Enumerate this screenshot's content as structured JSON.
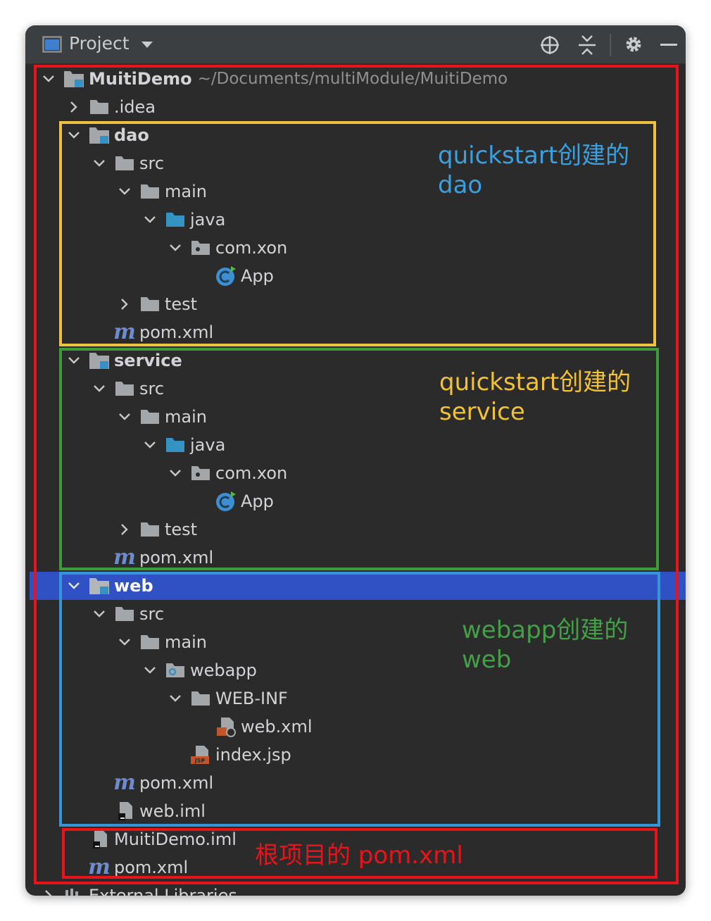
{
  "toolbar": {
    "title": "Project",
    "icons": [
      "window-icon",
      "dropdown-icon",
      "locate-icon",
      "collapse-icon",
      "gear-icon",
      "minimize-icon"
    ]
  },
  "tree": {
    "root": {
      "name": "MuitiDemo",
      "path": "~/Documents/multiModule/MuitiDemo"
    },
    "idea": ".idea",
    "dao": {
      "name": "dao",
      "src": "src",
      "main": "main",
      "java": "java",
      "pkg": "com.xon",
      "app": "App",
      "test": "test",
      "pom": "pom.xml"
    },
    "service": {
      "name": "service",
      "src": "src",
      "main": "main",
      "java": "java",
      "pkg": "com.xon",
      "app": "App",
      "test": "test",
      "pom": "pom.xml"
    },
    "web": {
      "name": "web",
      "src": "src",
      "main": "main",
      "webapp": "webapp",
      "webinf": "WEB-INF",
      "webxml": "web.xml",
      "index": "index.jsp",
      "pom": "pom.xml",
      "iml": "web.iml"
    },
    "root_iml": "MuitiDemo.iml",
    "root_pom": "pom.xml",
    "external": "External Libraries"
  },
  "annotations": {
    "dao": "quickstart创建的\ndao",
    "service": "quickstart创建的\nservice",
    "web": "webapp创建的\nweb",
    "root": "根项目的 pom.xml"
  },
  "colors": {
    "panel_bg": "#2b2b2b",
    "toolbar_bg": "#3c3f41",
    "selection": "#2f51c4",
    "red_box": "#e8141a",
    "yellow_box": "#f0c040",
    "green_box": "#3f9b3a",
    "blue_box": "#3496d6",
    "dao_note": "#3aa0e0",
    "service_note": "#f2c230",
    "web_note": "#43a047",
    "root_note": "#e8141a"
  }
}
